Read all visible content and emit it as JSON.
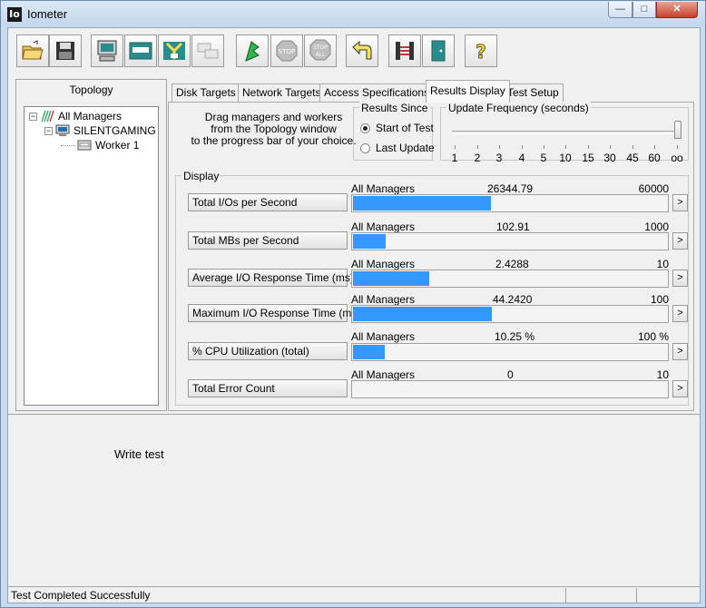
{
  "window": {
    "title": "Iometer",
    "app_icon": "Io",
    "min": "—",
    "max": "□",
    "close": "✕"
  },
  "toolbar": {
    "buttons": [
      "open-icon",
      "save-icon",
      "new-manager-icon",
      "new-disk-worker-icon",
      "new-network-worker-icon",
      "duplicate-worker-icon",
      "start-icon",
      "stop-icon",
      "stop-all-icon",
      "reset-workers-icon",
      "disconnect-icon",
      "exit-icon",
      "about-icon"
    ],
    "stop_label": "STOP",
    "stop_all_label_1": "STOP",
    "stop_all_label_2": "ALL",
    "about_label": "?"
  },
  "topology": {
    "label": "Topology",
    "items": [
      {
        "label": "All Managers",
        "expander": "−"
      },
      {
        "label": "SILENTGAMING",
        "expander": "−"
      },
      {
        "label": "Worker 1"
      }
    ]
  },
  "tabs": [
    {
      "label": "Disk Targets"
    },
    {
      "label": "Network Targets"
    },
    {
      "label": "Access Specifications"
    },
    {
      "label": "Results Display",
      "active": true
    },
    {
      "label": "Test Setup"
    }
  ],
  "results": {
    "hint_lines": [
      "Drag managers and workers",
      "from the Topology window",
      "to the progress bar of your choice."
    ],
    "since": {
      "label": "Results Since",
      "options": [
        {
          "label": "Start of Test",
          "checked": true
        },
        {
          "label": "Last Update",
          "checked": false
        }
      ]
    },
    "update": {
      "label": "Update Frequency (seconds)",
      "ticks": [
        "1",
        "2",
        "3",
        "4",
        "5",
        "10",
        "15",
        "30",
        "45",
        "60",
        "oo"
      ],
      "selected": "oo"
    },
    "display_label": "Display",
    "more_label": ">",
    "metrics": [
      {
        "button": "Total I/Os per Second",
        "source": "All Managers",
        "value": "26344.79",
        "max": "60000",
        "fraction": 0.439
      },
      {
        "button": "Total MBs per Second",
        "source": "All Managers",
        "value": "102.91",
        "max": "1000",
        "fraction": 0.103
      },
      {
        "button": "Average I/O Response Time (ms)",
        "source": "All Managers",
        "value": "2.4288",
        "max": "10",
        "fraction": 0.243
      },
      {
        "button": "Maximum I/O Response Time (ms)",
        "source": "All Managers",
        "value": "44.2420",
        "max": "100",
        "fraction": 0.442
      },
      {
        "button": "% CPU Utilization (total)",
        "source": "All Managers",
        "value": "10.25 %",
        "max": "100 %",
        "fraction": 0.1025
      },
      {
        "button": "Total Error Count",
        "source": "All Managers",
        "value": "0",
        "max": "10",
        "fraction": 0
      }
    ]
  },
  "note": "Write test",
  "status": "Test Completed Successfully"
}
